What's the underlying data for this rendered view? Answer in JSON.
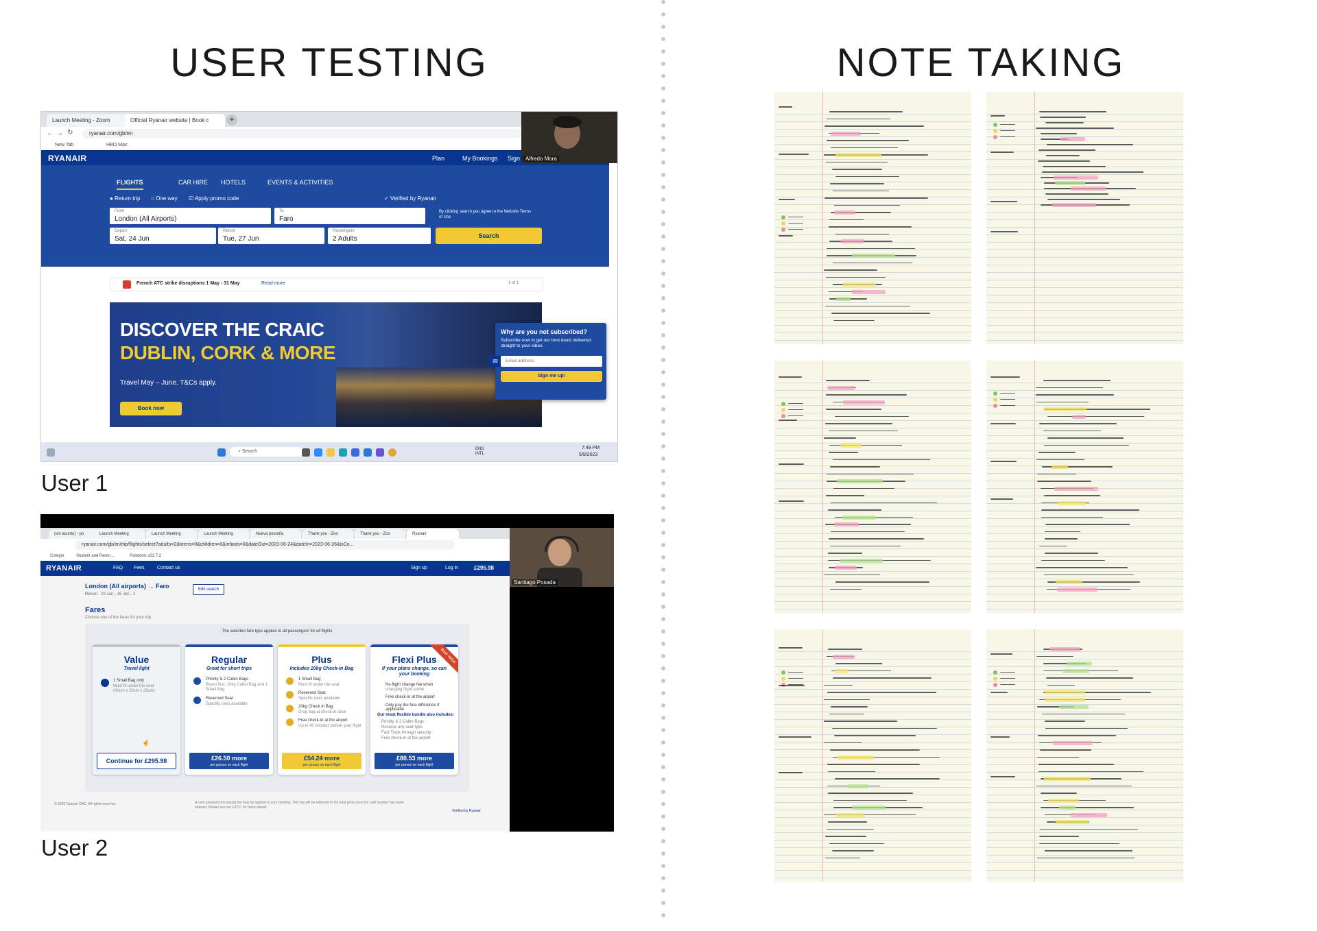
{
  "sections": {
    "left_title": "USER TESTING",
    "right_title": "NOTE TAKING"
  },
  "user1": {
    "label": "User 1",
    "tabs": [
      "Launch Meeting - Zoom",
      "Official Ryanair website | Book c"
    ],
    "url": "ryanair.com/gb/en",
    "bookmarks": [
      "New Tab",
      "HBO Max"
    ],
    "participant": "Alfredo Mora",
    "logo": "RYANAIR",
    "nav": [
      "Plan",
      "My Bookings",
      "Sign"
    ],
    "modes": [
      "FLIGHTS",
      "CAR HIRE",
      "HOTELS",
      "EVENTS & ACTIVITIES"
    ],
    "trip_options": [
      "Return trip",
      "One way",
      "Apply promo code"
    ],
    "verified": "Verified by Ryanair",
    "from_label": "From",
    "from_value": "London (All Airports)",
    "to_label": "To",
    "to_value": "Faro",
    "terms": "By clicking search you agree to the Website Terms of Use",
    "depart_label": "Depart",
    "depart_value": "Sat, 24 Jun",
    "return_label": "Return",
    "return_value": "Tue, 27 Jun",
    "passengers_label": "Passengers",
    "passengers_value": "2 Adults",
    "search_button": "Search",
    "alert_text": "French ATC strike disruptions 1 May - 31 May",
    "alert_link": "Read more",
    "alert_pager": "1 of 1",
    "banner_line1": "DISCOVER THE CRAIC",
    "banner_line2": "DUBLIN, CORK & MORE",
    "banner_sub": "Travel May – June. T&Cs apply.",
    "banner_button": "Book now",
    "popup_title": "Why are you not subscribed?",
    "popup_text": "Subscribe now to get our best deals delivered straight to your inbox.",
    "popup_placeholder": "Email address",
    "popup_button": "Sign me up!",
    "taskbar_search": "Search",
    "tray_lang": "ENG INTL",
    "tray_time": "7:49 PM",
    "tray_date": "5/8/2023"
  },
  "user2": {
    "label": "User 2",
    "tabs": [
      "(sin asunto) - po",
      "Launch Meeting",
      "Launch Meeting",
      "Launch Meeting",
      "Nueva pestaña",
      "Thank you - Zoo",
      "Thank you - Zoo",
      "Ryanair"
    ],
    "url": "ryanair.com/gb/en/trip/flights/select?adults=2&teens=0&children=0&infants=0&dateOut=2023-06-24&dateIn=2023-06-26&isCo...",
    "bookmarks": [
      "Colegio",
      "Student and Paren...",
      "Paletools v23.7.2"
    ],
    "participant": "Santiago Posada",
    "logo": "RYANAIR",
    "nav": [
      "FAQ",
      "Fees",
      "Contact us"
    ],
    "sign_up": "Sign up",
    "log_in": "Log in",
    "price": "£295.98",
    "route": "London (All airports) → Faro",
    "route_sub": "Return · 23 Jun - 25 Jun · 2",
    "edit_search": "Edit search",
    "fares_title": "Fares",
    "fares_sub": "Choose one of the fares for your trip",
    "fares_note": "The selected fare type applies to all passengers for all flights",
    "fares": [
      {
        "name": "Value",
        "sub": "Travel light",
        "features": [
          "1 Small Bag only",
          "Must fit under the seat",
          "(40cm x 20cm x 25cm)"
        ],
        "button": "Continue for £295.98",
        "button_sub": ""
      },
      {
        "name": "Regular",
        "sub": "Great for short trips",
        "features": [
          "Priority & 2 Cabin Bags",
          "Board first, 10kg Cabin Bag and 1",
          "Small Bag",
          "Reserved Seat",
          "Specific rows available"
        ],
        "button": "£26.50 more",
        "button_sub": "per person on each flight"
      },
      {
        "name": "Plus",
        "sub": "Includes 20kg Check-in Bag",
        "features": [
          "1 Small Bag",
          "Must fit under the seat",
          "Reserved Seat",
          "Specific rows available",
          "20kg Check in Bag",
          "Drop bag at check-in desk",
          "Free check-in at the airport",
          "Up to 40 minutes before your flight"
        ],
        "button": "£54.24 more",
        "button_sub": "per person on each flight"
      },
      {
        "name": "Flexi Plus",
        "sub": "If your plans change, so can your booking",
        "features": [
          "No flight change fee when",
          "changing flight online",
          "Free check-in at the airport",
          "Only pay the fare difference if applicable",
          "Our most flexible bundle also includes:",
          "Priority & 2 Cabin Bags",
          "Reserve any seat type",
          "Fast Track through security",
          "Free check-in at the airport"
        ],
        "button": "£80.53 more",
        "button_sub": "per person on each flight",
        "ribbon": "Best Value"
      }
    ],
    "footer_copy": "© 2023 Ryanair DAC. All rights reserved.",
    "footer_note": "A card payment processing fee may be applied to your booking. This fee will be reflected in the total price once the card number has been entered. Please see our GTCC for more details.",
    "footer_verified": "Verified by Ryanair"
  },
  "notes": {
    "pages": 6,
    "rating_legend": [
      "positive",
      "neutral",
      "negative"
    ],
    "colors": {
      "positive": "#7cc26d",
      "neutral": "#f0d65a",
      "negative": "#e88aa0",
      "highlight_yellow": "#f3e66a",
      "highlight_pink": "#f2a3c2",
      "highlight_green": "#b6e38f"
    }
  },
  "colors": {
    "ryanair_blue": "#073590",
    "ryanair_yellow": "#f1c933",
    "hero_blue": "#1e4aa0"
  }
}
